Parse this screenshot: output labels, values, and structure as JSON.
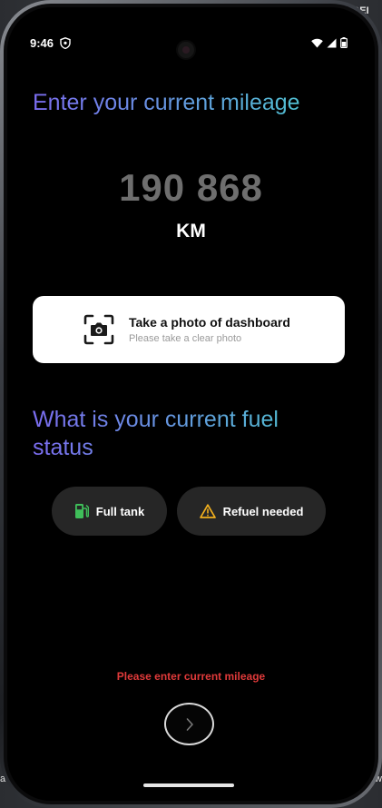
{
  "status_bar": {
    "time": "9:46"
  },
  "background": {
    "top_right_text": "EDEI",
    "bottom_left_text": "ar",
    "bottom_right_text": "w"
  },
  "mileage": {
    "heading": "Enter your current mileage",
    "value": "190 868",
    "unit": "KM"
  },
  "photo_card": {
    "title": "Take a photo of dashboard",
    "subtitle": "Please take a clear photo"
  },
  "fuel": {
    "heading": "What is your current fuel status",
    "options": [
      {
        "label": "Full tank",
        "icon": "fuel-pump-icon",
        "color": "#3fbf5a"
      },
      {
        "label": "Refuel needed",
        "icon": "warning-icon",
        "color": "#f2b01e"
      }
    ]
  },
  "error": {
    "message": "Please enter current mileage",
    "color": "#e03a3a"
  },
  "navigation": {
    "next_icon": "chevron-right-icon"
  },
  "colors": {
    "heading_gradient_start": "#7b6cf0",
    "heading_gradient_end": "#4fc0d0"
  }
}
